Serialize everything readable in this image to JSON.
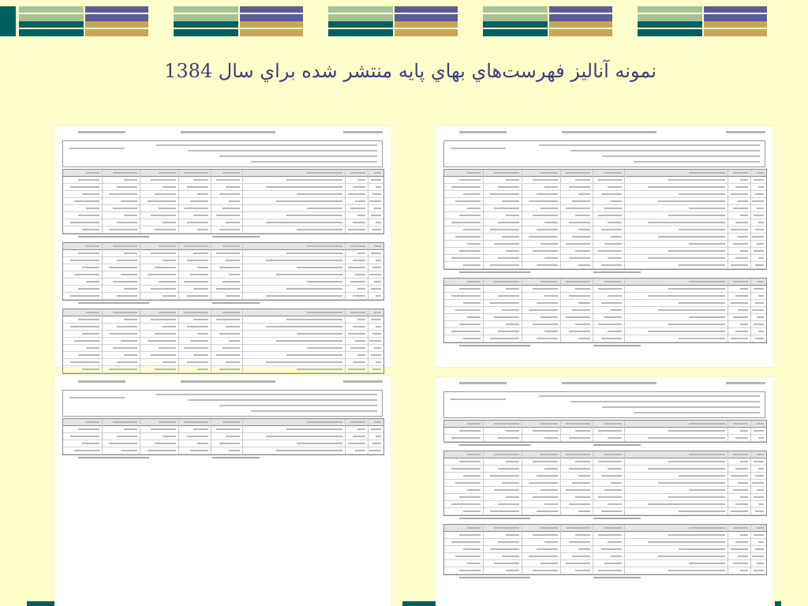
{
  "slide": {
    "title": "نمونه آناليز فهرست‌هاي بهاي پايه منتشر شده براي سال 1384"
  },
  "colors": {
    "background": "#ffffcc",
    "title": "#3d3d7a",
    "banner_sage": "#a6c29a",
    "banner_purple": "#5c5c99",
    "banner_teal": "#005f5f",
    "banner_gold": "#c9a55a"
  },
  "pages": [
    {
      "id": "top-left"
    },
    {
      "id": "top-right"
    },
    {
      "id": "bottom-left"
    },
    {
      "id": "bottom-right"
    }
  ]
}
